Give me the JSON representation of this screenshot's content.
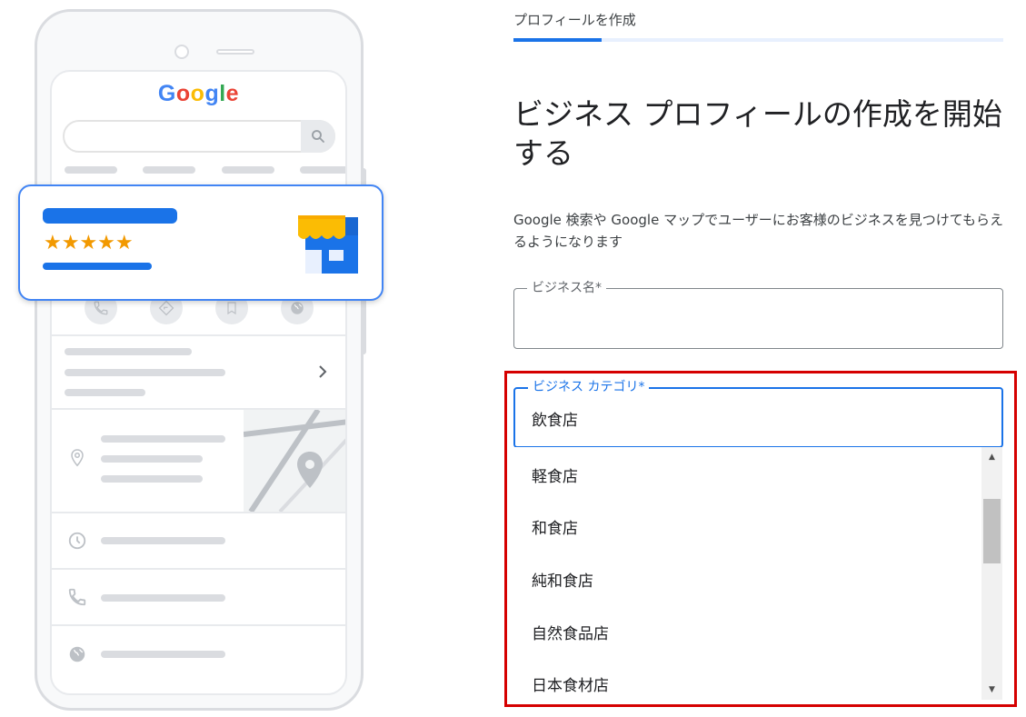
{
  "illustration": {
    "logo_letters": [
      {
        "char": "G",
        "color": "#4285F4"
      },
      {
        "char": "o",
        "color": "#EA4335"
      },
      {
        "char": "o",
        "color": "#FBBC05"
      },
      {
        "char": "g",
        "color": "#4285F4"
      },
      {
        "char": "l",
        "color": "#34A853"
      },
      {
        "char": "e",
        "color": "#EA4335"
      }
    ],
    "stars": "★★★★★",
    "rating": 5,
    "icons": [
      "search-icon",
      "phone-icon",
      "directions-icon",
      "bookmark-icon",
      "globe-icon",
      "chevron-right-icon",
      "location-pin-icon",
      "clock-icon",
      "storefront-icon"
    ]
  },
  "form": {
    "breadcrumb": "プロフィールを作成",
    "progress": 0.18,
    "heading": "ビジネス プロフィールの作成を開始する",
    "description": "Google 検索や Google マップでユーザーにお客様のビジネスを見つけてもらえるようになります",
    "business_name": {
      "label": "ビジネス名*",
      "value": ""
    },
    "business_category": {
      "label": "ビジネス カテゴリ*",
      "value": "飲食店"
    },
    "suggestions": [
      "軽食店",
      "和食店",
      "純和食店",
      "自然食品店",
      "日本食材店"
    ]
  },
  "colors": {
    "accent": "#1a73e8",
    "highlight": "#d50000",
    "star": "#f29900"
  }
}
